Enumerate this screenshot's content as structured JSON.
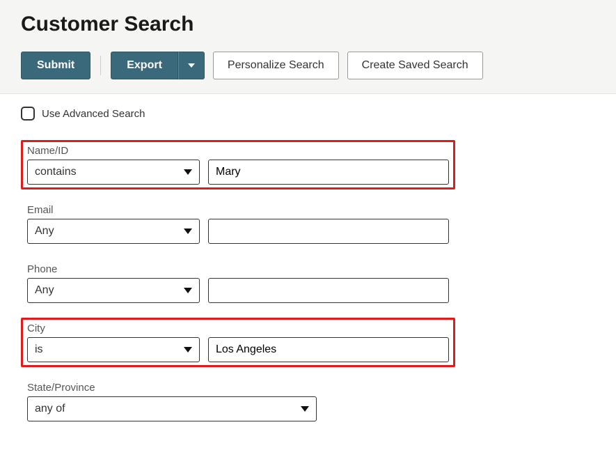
{
  "header": {
    "title": "Customer Search"
  },
  "toolbar": {
    "submit_label": "Submit",
    "export_label": "Export",
    "personalize_label": "Personalize Search",
    "create_saved_label": "Create Saved Search"
  },
  "advanced": {
    "label": "Use Advanced Search",
    "checked": false
  },
  "fields": {
    "name_id": {
      "label": "Name/ID",
      "operator": "contains",
      "value": "Mary",
      "highlight": true
    },
    "email": {
      "label": "Email",
      "operator": "Any",
      "value": "",
      "highlight": false
    },
    "phone": {
      "label": "Phone",
      "operator": "Any",
      "value": "",
      "highlight": false
    },
    "city": {
      "label": "City",
      "operator": "is",
      "value": "Los Angeles",
      "highlight": true
    },
    "state": {
      "label": "State/Province",
      "operator": "any of",
      "value": "",
      "highlight": false
    }
  }
}
